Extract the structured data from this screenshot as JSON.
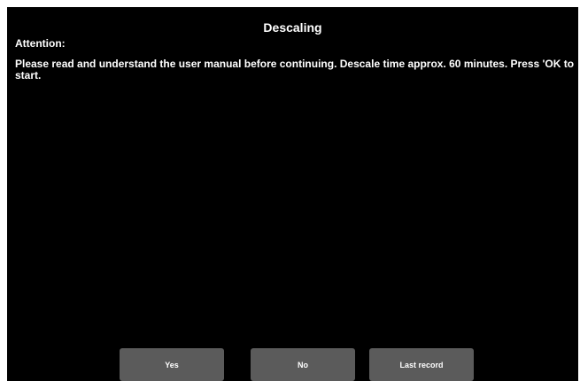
{
  "dialog": {
    "title": "Descaling",
    "attention_label": "Attention:",
    "message": "Please read and understand the user manual before continuing. Descale time approx. 60 minutes. Press 'OK to start."
  },
  "buttons": {
    "yes_label": "Yes",
    "no_label": "No",
    "last_record_label": "Last record"
  },
  "colors": {
    "background": "#000000",
    "text": "#ffffff",
    "button": "#5b5b5b"
  }
}
